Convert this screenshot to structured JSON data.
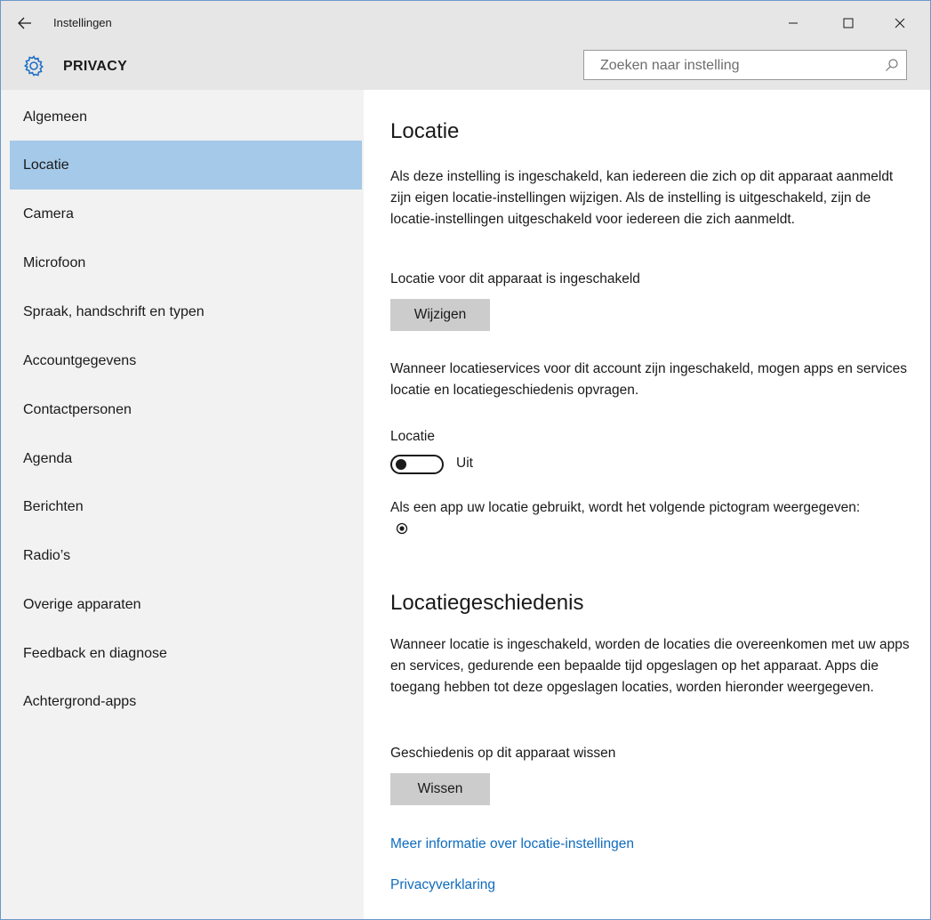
{
  "window": {
    "title": "Instellingen",
    "back_icon": "back-arrow-icon",
    "controls": [
      "minimize-icon",
      "maximize-icon",
      "close-icon"
    ]
  },
  "header": {
    "title": "PRIVACY",
    "icon": "gear-icon",
    "search_placeholder": "Zoeken naar instelling"
  },
  "sidebar": {
    "items": [
      {
        "label": "Algemeen"
      },
      {
        "label": "Locatie",
        "active": true
      },
      {
        "label": "Camera"
      },
      {
        "label": "Microfoon"
      },
      {
        "label": "Spraak, handschrift en typen"
      },
      {
        "label": "Accountgegevens"
      },
      {
        "label": "Contactpersonen"
      },
      {
        "label": "Agenda"
      },
      {
        "label": "Berichten"
      },
      {
        "label": "Radio’s"
      },
      {
        "label": "Overige apparaten"
      },
      {
        "label": "Feedback en diagnose"
      },
      {
        "label": "Achtergrond-apps"
      }
    ],
    "active_color": "#a5c9e8"
  },
  "content": {
    "section1_title": "Locatie",
    "section1_desc": "Als deze instelling is ingeschakeld, kan iedereen die zich op dit apparaat aanmeldt zijn eigen locatie-instellingen wijzigen. Als de instelling is uitgeschakeld, zijn de locatie-instellingen uitgeschakeld voor iedereen die zich aanmeldt.",
    "device_status": "Locatie voor dit apparaat is ingeschakeld",
    "change_button": "Wijzigen",
    "account_desc": "Wanneer locatieservices voor dit account zijn ingeschakeld, mogen apps en services locatie en locatiegeschiedenis opvragen.",
    "toggle_label": "Locatie",
    "toggle_state": "Uit",
    "toggle_on": false,
    "icon_note": "Als een app uw locatie gebruikt, wordt het volgende pictogram weergegeven:",
    "section2_title": "Locatiegeschiedenis",
    "section2_desc": "Wanneer locatie is ingeschakeld, worden de locaties die overeenkomen met uw apps en services, gedurende een bepaalde tijd opgeslagen op het apparaat. Apps die toegang hebben tot deze opgeslagen locaties, worden hieronder weergegeven.",
    "clear_label": "Geschiedenis op dit apparaat wissen",
    "clear_button": "Wissen",
    "link_more": "Meer informatie over locatie-instellingen",
    "link_privacy": "Privacyverklaring",
    "link_color": "#0f6cbd"
  }
}
